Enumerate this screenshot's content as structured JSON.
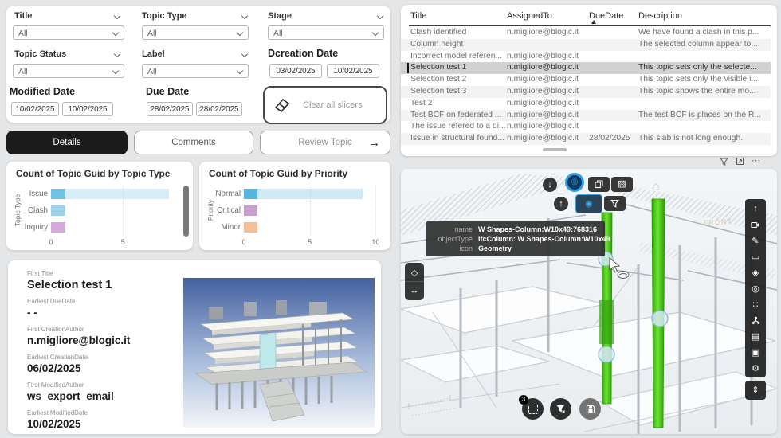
{
  "slicer_panel": {
    "dropdowns": [
      {
        "label": "Title",
        "value": "All"
      },
      {
        "label": "Topic Type",
        "value": "All"
      },
      {
        "label": "Stage",
        "value": "All"
      },
      {
        "label": "Topic Status",
        "value": "All"
      },
      {
        "label": "Label",
        "value": "All"
      }
    ],
    "date_ranges": [
      {
        "label": "Dcreation Date",
        "from": "03/02/2025",
        "to": "10/02/2025"
      },
      {
        "label": "Modified Date",
        "from": "10/02/2025",
        "to": "10/02/2025"
      },
      {
        "label": "Due Date",
        "from": "28/02/2025",
        "to": "28/02/2025"
      }
    ],
    "clear_all_label": "Clear all slicers"
  },
  "tab_buttons": [
    {
      "label": "Details"
    },
    {
      "label": "Comments"
    },
    {
      "label": "Review Topic"
    }
  ],
  "chart_data": [
    {
      "type": "bar",
      "orientation": "horizontal",
      "title": "Count of Topic Guid by Topic Type",
      "ylabel": "Topic Type",
      "xlabel": "",
      "categories": [
        "Issue",
        "Clash",
        "Inquiry"
      ],
      "series": [
        {
          "name": "highlighted",
          "values": [
            1,
            1,
            1
          ]
        },
        {
          "name": "total",
          "values": [
            9,
            1,
            1
          ]
        }
      ],
      "xticks": [
        0,
        5
      ],
      "xlim": [
        0,
        8.2
      ],
      "legend": "none",
      "colors": [
        {
          "sel": "#6fc3e6",
          "dim": "#d7edf8"
        },
        {
          "sel": "#9ed1e8",
          "dim": "#9ed1e8"
        },
        {
          "sel": "#d5a9db",
          "dim": "#d5a9db"
        }
      ]
    },
    {
      "type": "bar",
      "orientation": "horizontal",
      "title": "Count of Topic Guid by Priority",
      "ylabel": "Priority",
      "xlabel": "",
      "categories": [
        "Normal",
        "Critical",
        "Minor"
      ],
      "series": [
        {
          "name": "highlighted",
          "values": [
            1,
            1,
            1
          ]
        },
        {
          "name": "total",
          "values": [
            9,
            1,
            1
          ]
        }
      ],
      "xticks": [
        0,
        5,
        10
      ],
      "xlim": [
        0,
        10.4
      ],
      "legend": "none",
      "colors": [
        {
          "sel": "#57b6e0",
          "dim": "#cfe9f7"
        },
        {
          "sel": "#c79fcc",
          "dim": "#c79fcc"
        },
        {
          "sel": "#f4be97",
          "dim": "#f4be97"
        }
      ]
    }
  ],
  "detail_fields": [
    {
      "label": "First Title",
      "value": "Selection test 1"
    },
    {
      "label": "Earliest DueDate",
      "value": "- -"
    },
    {
      "label": "First CreationAuthor",
      "value": "n.migliore@blogic.it"
    },
    {
      "label": "Earliest CreationDate",
      "value": "06/02/2025"
    },
    {
      "label": "First ModifiedAuthor",
      "value": "ws  export  email"
    },
    {
      "label": "Earliest ModifiedDate",
      "value": "10/02/2025"
    }
  ],
  "table": {
    "columns": [
      "Title",
      "AssignedTo",
      "DueDate",
      "Description"
    ],
    "sort_column": "DueDate",
    "sort_direction": "asc",
    "selected_row": 3,
    "rows": [
      {
        "title": "Clash identified",
        "assignedTo": "n.migliore@blogic.it",
        "dueDate": "",
        "description": "We have found a clash in this p..."
      },
      {
        "title": "Column height",
        "assignedTo": "",
        "dueDate": "",
        "description": "The selected column appear to..."
      },
      {
        "title": "Incorrect model referen...",
        "assignedTo": "n.migliore@blogic.it",
        "dueDate": "",
        "description": ""
      },
      {
        "title": "Selection test 1",
        "assignedTo": "n.migliore@blogic.it",
        "dueDate": "",
        "description": "This topic sets only the selecte..."
      },
      {
        "title": "Selection test 2",
        "assignedTo": "n.migliore@blogic.it",
        "dueDate": "",
        "description": "This topic sets only the visible i..."
      },
      {
        "title": "Selection test 3",
        "assignedTo": "n.migliore@blogic.it",
        "dueDate": "",
        "description": "This topic shows the entire mo..."
      },
      {
        "title": "Test 2",
        "assignedTo": "n.migliore@blogic.it",
        "dueDate": "",
        "description": ""
      },
      {
        "title": "Test BCF on federated ...",
        "assignedTo": "n.migliore@blogic.it",
        "dueDate": "",
        "description": "The test BCF is places on the R..."
      },
      {
        "title": "The issue refered to a di...",
        "assignedTo": "n.migliore@blogic.it",
        "dueDate": "",
        "description": ""
      },
      {
        "title": "Issue in structural found...",
        "assignedTo": "n.migliore@blogic.it",
        "dueDate": "28/02/2025",
        "description": "This slab is not long enough."
      }
    ]
  },
  "viewer": {
    "tooltip": {
      "rows": [
        {
          "label": "name",
          "value": "W Shapes-Column:W10x49:768316"
        },
        {
          "label": "objectType",
          "value": "IfcColumn: W Shapes-Column:W10x49"
        },
        {
          "label": "icon",
          "value": "Geometry"
        }
      ]
    },
    "badge_count": "3",
    "ghost_label": "FRONT",
    "highlight_color": "#4ecb1a"
  },
  "glyphs": {
    "arrow-down-icon": "↓",
    "arrow-up-icon": "↑",
    "orbit-icon": "◎",
    "selection-target-icon": "◉",
    "hatch-icon": "▨",
    "pointer-up-icon": "↑",
    "pencil-icon": "✎",
    "rectangle-icon": "▭",
    "cube-icon": "◈",
    "globe-icon": "◎",
    "dots-icon": "∷",
    "layers-icon": "▤",
    "image-icon": "▣",
    "gear-icon": "⚙",
    "collapse-icon": "⇕",
    "home-icon": "⌂",
    "more-icon": "⋯",
    "diamond-icon": "◇",
    "measure-icon": "↔",
    "arrow-right-icon": "→"
  }
}
